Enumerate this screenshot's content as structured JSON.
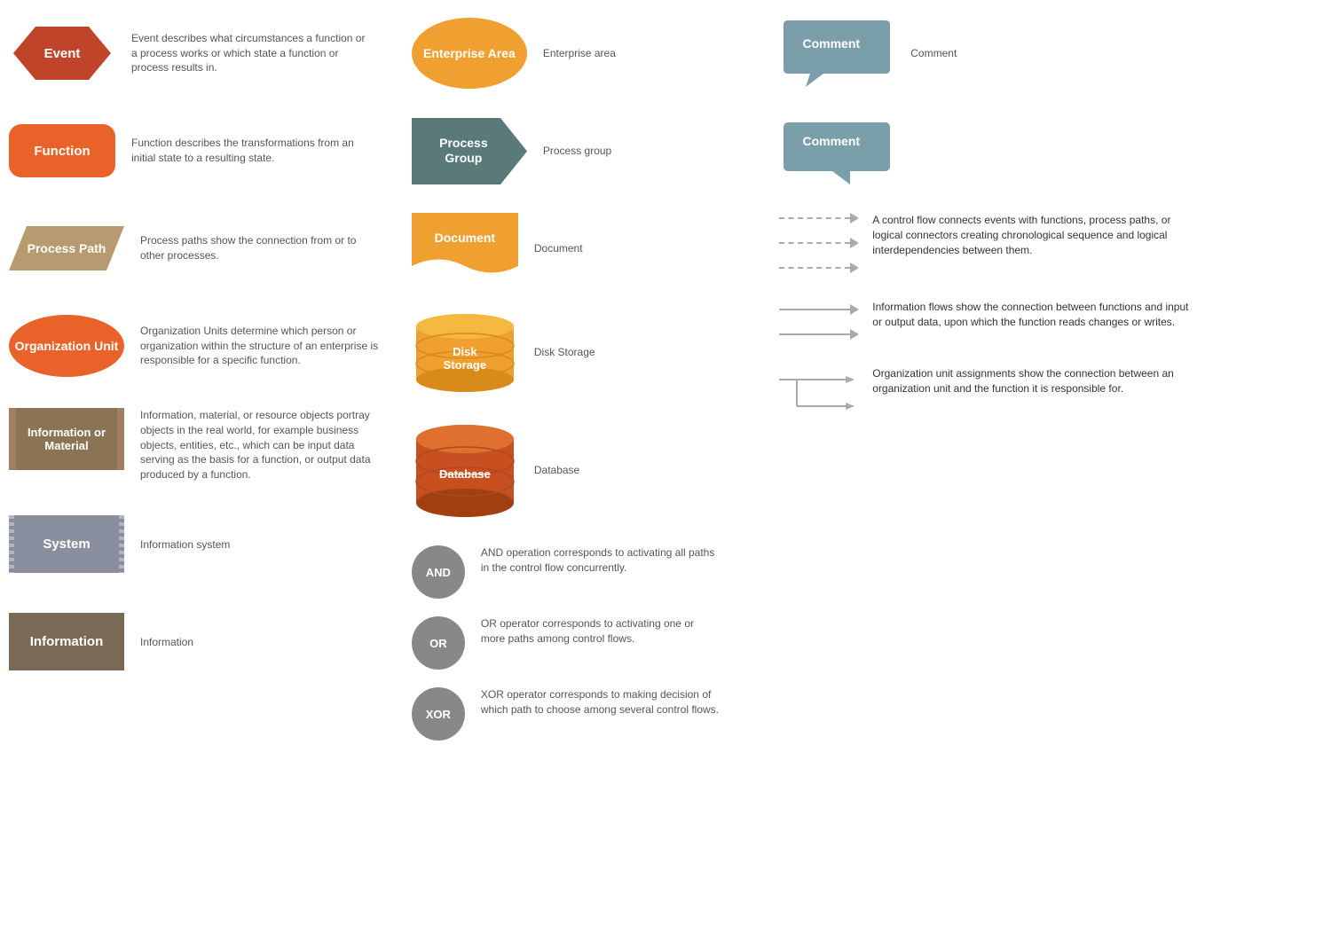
{
  "col1": {
    "items": [
      {
        "shape": "hexagon",
        "label": "Event",
        "color": "#c0442a",
        "description": "Event describes what circumstances a function or a process works or which state a function or process results in."
      },
      {
        "shape": "rounded",
        "label": "Function",
        "color": "#e8622a",
        "description": "Function describes the transformations from an initial state to a resulting state."
      },
      {
        "shape": "parallelogram",
        "label": "Process Path",
        "color": "#b89a70",
        "description": "Process paths show the connection from or to other processes."
      },
      {
        "shape": "ellipse",
        "label": "Organization Unit",
        "color": "#e8622a",
        "description": "Organization Units determine which person or organization within the structure of an enterprise is responsible for a specific function."
      },
      {
        "shape": "info-material",
        "label": "Information or Material",
        "color": "#8b7355",
        "description": "Information, material, or resource objects portray objects in the real world, for example business objects, entities, etc., which can be input data serving as the basis for a function, or output data produced by a function."
      },
      {
        "shape": "system",
        "label": "System",
        "color": "#8a8fa0",
        "description": "Information system"
      },
      {
        "shape": "information",
        "label": "Information",
        "color": "#7a6a55",
        "description": "Information"
      }
    ]
  },
  "col2": {
    "items": [
      {
        "shape": "enterprise",
        "label": "Enterprise Area",
        "color": "#f0a030",
        "description": "Enterprise area"
      },
      {
        "shape": "process-group",
        "label": "Process Group",
        "color": "#5a7a7a",
        "description": "Process group"
      },
      {
        "shape": "document",
        "label": "Document",
        "color": "#f0a030",
        "description": "Document"
      },
      {
        "shape": "disk",
        "label": "Disk Storage",
        "color": "#f0a030",
        "description": "Disk Storage"
      },
      {
        "shape": "database",
        "label": "Database",
        "color": "#c0502a",
        "description": "Database"
      },
      {
        "shape": "logic",
        "items": [
          {
            "label": "AND",
            "color": "#888888",
            "description": "AND operation corresponds to activating all paths in the control flow concurrently."
          },
          {
            "label": "OR",
            "color": "#888888",
            "description": "OR operator corresponds to activating one or more paths among control flows."
          },
          {
            "label": "XOR",
            "color": "#888888",
            "description": "XOR operator corresponds to making decision of which path to choose among several control flows."
          }
        ]
      }
    ]
  },
  "col3": {
    "items": [
      {
        "shape": "comment-top",
        "label": "Comment",
        "color": "#7a9faa",
        "description": "Comment"
      },
      {
        "shape": "comment-bottom",
        "label": "Comment",
        "color": "#7a9faa",
        "description": ""
      },
      {
        "shape": "control-flow",
        "description": "A control flow connects events with functions, process paths, or logical connectors creating chronological sequence and logical interdependencies between them."
      },
      {
        "shape": "info-flow",
        "description": "Information flows show the connection between functions and input or output data, upon which the function reads changes or writes."
      },
      {
        "shape": "org-connect",
        "description": "Organization unit assignments show the connection between an organization unit and the function it is responsible for."
      }
    ]
  }
}
